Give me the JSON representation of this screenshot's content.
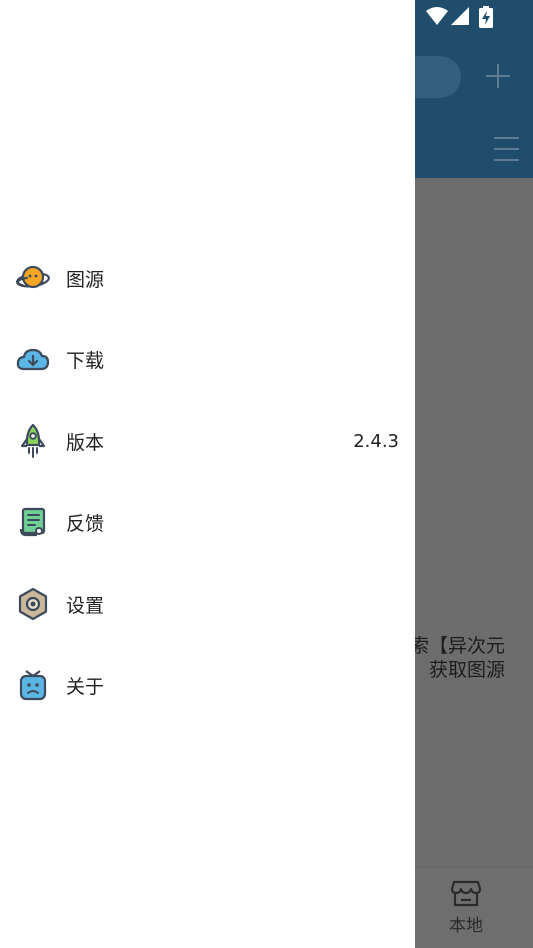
{
  "app": {
    "notice_lines": [
      "索【异次元",
      "获取图源"
    ],
    "bottom_nav": {
      "local_label": "本地",
      "local_icon": "store-icon"
    },
    "toolbar_icons": [
      "add-icon",
      "menu-icon"
    ]
  },
  "status_bar": {
    "icons": [
      "wifi-icon",
      "signal-icon",
      "battery-charging-icon"
    ]
  },
  "drawer": {
    "items": [
      {
        "label": "图源",
        "icon": "planet-icon",
        "value": ""
      },
      {
        "label": "下载",
        "icon": "cloud-download-icon",
        "value": ""
      },
      {
        "label": "版本",
        "icon": "rocket-icon",
        "value": "2.4.3"
      },
      {
        "label": "反馈",
        "icon": "document-icon",
        "value": ""
      },
      {
        "label": "设置",
        "icon": "hex-nut-icon",
        "value": ""
      },
      {
        "label": "关于",
        "icon": "robot-icon",
        "value": ""
      }
    ]
  },
  "colors": {
    "toolbar": "#214d6d",
    "scrim": "#6d6d6d",
    "drawer_bg": "#ffffff",
    "text": "#222222"
  }
}
